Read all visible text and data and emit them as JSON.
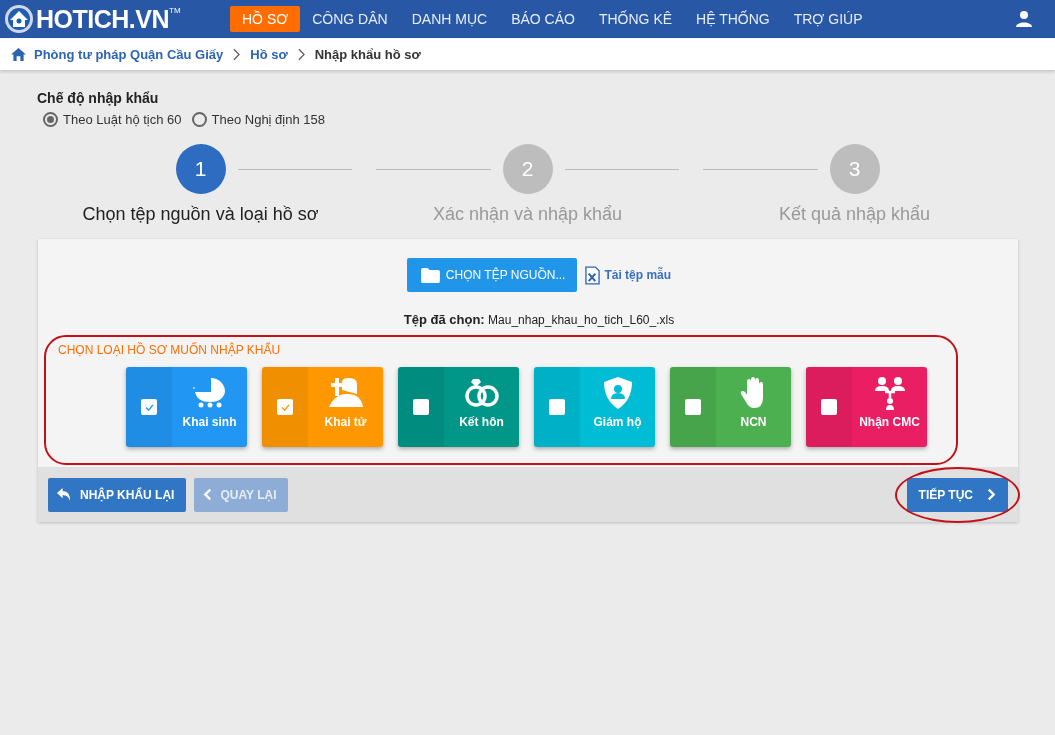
{
  "navbar": {
    "logo": "HOTICH.VN",
    "logo_mark": "TM",
    "menu": [
      {
        "label": "HỒ SƠ",
        "selected": true
      },
      {
        "label": "CÔNG DÂN",
        "selected": false
      },
      {
        "label": "DANH MỤC",
        "selected": false
      },
      {
        "label": "BÁO CÁO",
        "selected": false
      },
      {
        "label": "THỐNG KÊ",
        "selected": false
      },
      {
        "label": "HỆ THỐNG",
        "selected": false
      },
      {
        "label": "TRỢ GIÚP",
        "selected": false
      }
    ]
  },
  "breadcrumb": [
    "Phòng tư pháp Quận Cầu Giấy",
    "Hồ sơ",
    "Nhập khẩu hồ sơ"
  ],
  "import_mode": {
    "title": "Chế độ nhập khẩu",
    "options": [
      {
        "label": "Theo Luật hộ tịch 60",
        "selected": true
      },
      {
        "label": "Theo Nghị định 158",
        "selected": false
      }
    ]
  },
  "steps": [
    {
      "number": "1",
      "label": "Chọn tệp nguồn và loại hồ sơ",
      "selected": true
    },
    {
      "number": "2",
      "label": "Xác nhận và nhập khẩu",
      "selected": false
    },
    {
      "number": "3",
      "label": "Kết quả nhập khẩu",
      "selected": false
    }
  ],
  "choose_file_button": "CHỌN TỆP NGUỒN...",
  "template_link": "Tải tệp mẫu",
  "selected_file": {
    "label": "Tệp đã chọn:",
    "value": "Mau_nhap_khau_ho_tich_L60_.xls"
  },
  "record_types": {
    "title": "CHỌN LOẠI HỒ SƠ MUỐN NHẬP KHẨU",
    "items": [
      {
        "label": "Khai sinh",
        "checked": true,
        "color": "#2196f3",
        "kind": "pram"
      },
      {
        "label": "Khai tử",
        "checked": true,
        "color": "#ff9800",
        "kind": "grave"
      },
      {
        "label": "Kết hôn",
        "checked": false,
        "color": "#009688",
        "kind": "rings"
      },
      {
        "label": "Giám hộ",
        "checked": false,
        "color": "#00bcd4",
        "kind": "shield"
      },
      {
        "label": "NCN",
        "checked": false,
        "color": "#4caf50",
        "kind": "hand"
      },
      {
        "label": "Nhận CMC",
        "checked": false,
        "color": "#e91e63",
        "kind": "people"
      }
    ]
  },
  "footer_buttons": [
    {
      "label": "NHẬP KHẨU LẠI",
      "kind": "reload",
      "disabled": false
    },
    {
      "label": "QUAY LẠI",
      "kind": "back",
      "disabled": true
    },
    {
      "label": "TIẾP TỤC",
      "kind": "next",
      "disabled": false
    }
  ]
}
